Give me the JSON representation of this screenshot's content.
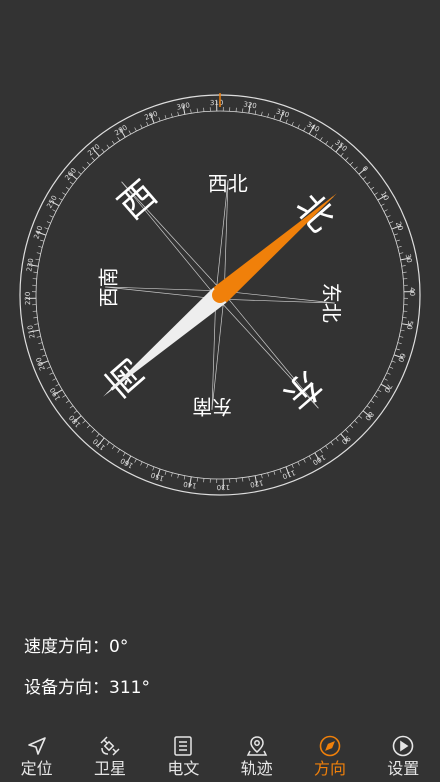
{
  "compass": {
    "heading_deg": 311,
    "ring_numbers": [
      "0",
      "10",
      "20",
      "30",
      "40",
      "50",
      "60",
      "70",
      "80",
      "90",
      "100",
      "110",
      "120",
      "130",
      "140",
      "150",
      "160",
      "170",
      "180",
      "190",
      "200",
      "210",
      "220",
      "230",
      "240",
      "250",
      "260",
      "270",
      "280",
      "290",
      "300",
      "310",
      "320",
      "330",
      "340",
      "350"
    ],
    "cardinals": {
      "north": "北",
      "east": "东",
      "south": "南",
      "west": "西"
    },
    "intercardinals": {
      "northwest": "西北",
      "northeast": "东北",
      "southeast": "东南",
      "southwest": "西南"
    },
    "colors": {
      "needle_north": "#f0800a",
      "needle_south": "#eeeeee",
      "ring": "#dddddd",
      "background": "#333333"
    }
  },
  "info": {
    "speed": "速度方向：0°",
    "device": "设备方向：311°"
  },
  "tabs": [
    {
      "label": "定位",
      "icon": "navigation-arrow-icon",
      "active": false
    },
    {
      "label": "卫星",
      "icon": "satellite-icon",
      "active": false
    },
    {
      "label": "电文",
      "icon": "document-icon",
      "active": false
    },
    {
      "label": "轨迹",
      "icon": "map-pin-icon",
      "active": false
    },
    {
      "label": "方向",
      "icon": "compass-icon",
      "active": true
    },
    {
      "label": "设置",
      "icon": "play-circle-icon",
      "active": false
    }
  ]
}
